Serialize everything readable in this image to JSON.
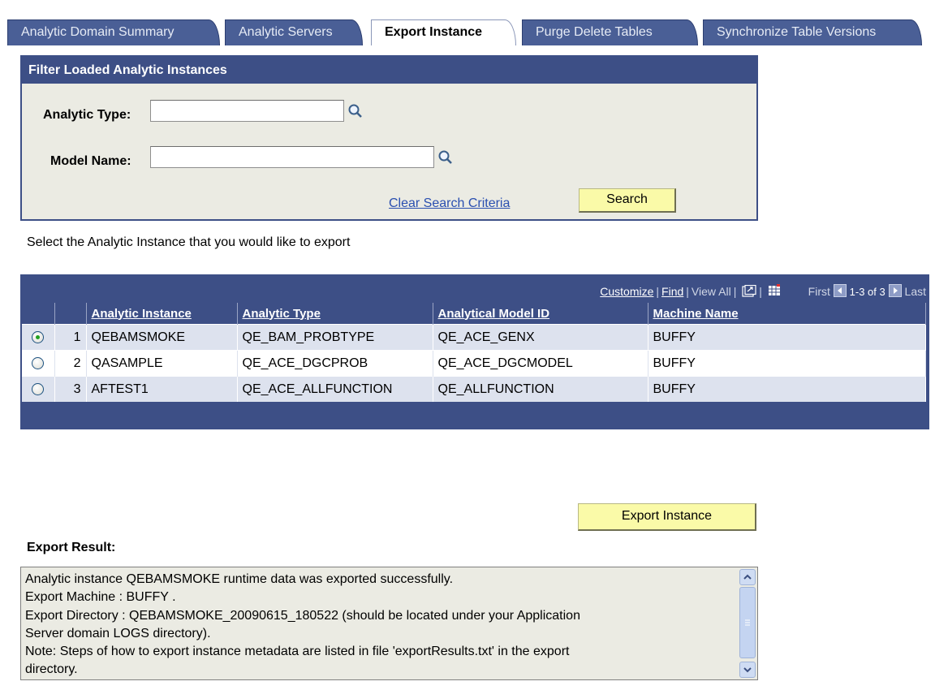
{
  "tabs": [
    {
      "label": "Analytic Domain Summary"
    },
    {
      "label": "Analytic Servers"
    },
    {
      "label": "Export Instance"
    },
    {
      "label": "Purge Delete Tables"
    },
    {
      "label": "Synchronize Table Versions"
    }
  ],
  "filter": {
    "title": "Filter Loaded Analytic Instances",
    "analytic_type_label": "Analytic Type:",
    "analytic_type_value": "",
    "model_name_label": "Model Name:",
    "model_name_value": "",
    "clear_label": "Clear Search Criteria",
    "search_label": "Search"
  },
  "instruction": "Select the Analytic Instance that you would like to export",
  "grid": {
    "tools": {
      "customize": "Customize",
      "find": "Find",
      "view_all": "View All",
      "first": "First",
      "range": "1-3 of 3",
      "last": "Last"
    },
    "columns": [
      "Analytic Instance",
      "Analytic Type",
      "Analytical Model ID",
      "Machine Name"
    ],
    "rows": [
      {
        "num": "1",
        "instance": "QEBAMSMOKE",
        "type": "QE_BAM_PROBTYPE",
        "model": "QE_ACE_GENX",
        "machine": "BUFFY",
        "selected": true
      },
      {
        "num": "2",
        "instance": "QASAMPLE",
        "type": "QE_ACE_DGCPROB",
        "model": "QE_ACE_DGCMODEL",
        "machine": "BUFFY",
        "selected": false
      },
      {
        "num": "3",
        "instance": "AFTEST1",
        "type": "QE_ACE_ALLFUNCTION",
        "model": "QE_ALLFUNCTION",
        "machine": "BUFFY",
        "selected": false
      }
    ]
  },
  "export_button": "Export Instance",
  "result": {
    "label": "Export Result:",
    "text": "Analytic instance QEBAMSMOKE runtime data was exported successfully.\nExport Machine : BUFFY .\nExport Directory : QEBAMSMOKE_20090615_180522 (should be located under your Application\nServer domain LOGS directory).\nNote: Steps of how to export instance metadata are listed in file 'exportResults.txt' in the export\ndirectory."
  },
  "colors": {
    "header": "#3d4f86",
    "tab": "#4a5f96",
    "button": "#fafaa8",
    "panel": "#ebebe3",
    "row_alt": "#dde2ee",
    "link": "#2a4fb0"
  }
}
